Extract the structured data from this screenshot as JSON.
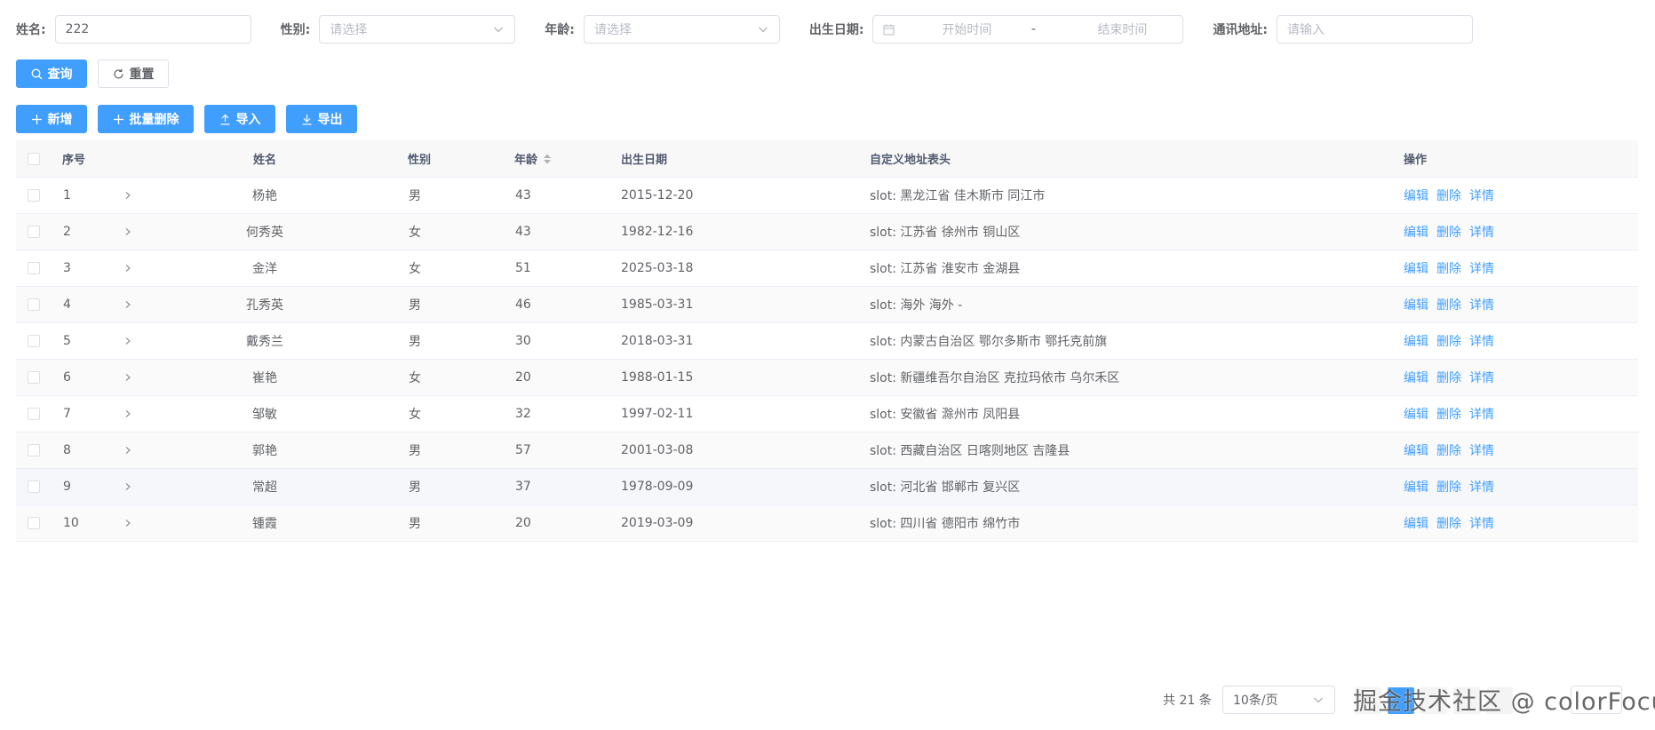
{
  "filters": {
    "name": {
      "label": "姓名:",
      "value": "222"
    },
    "gender": {
      "label": "性别:",
      "placeholder": "请选择"
    },
    "age": {
      "label": "年龄:",
      "placeholder": "请选择"
    },
    "birthdate": {
      "label": "出生日期:",
      "start_placeholder": "开始时间",
      "separator": "-",
      "end_placeholder": "结束时间"
    },
    "address": {
      "label": "通讯地址:",
      "placeholder": "请输入"
    }
  },
  "search_buttons": {
    "query": "查询",
    "reset": "重置"
  },
  "toolbar": {
    "add": "新增",
    "batch_delete": "批量删除",
    "import": "导入",
    "export": "导出"
  },
  "table": {
    "headers": {
      "index": "序号",
      "name": "姓名",
      "gender": "性别",
      "age": "年龄",
      "birthdate": "出生日期",
      "address": "自定义地址表头",
      "actions": "操作"
    },
    "actions": {
      "edit": "编辑",
      "delete": "删除",
      "detail": "详情"
    },
    "rows": [
      {
        "index": "1",
        "name": "杨艳",
        "gender": "男",
        "age": "43",
        "birthdate": "2015-12-20",
        "address": "slot: 黑龙江省 佳木斯市 同江市"
      },
      {
        "index": "2",
        "name": "何秀英",
        "gender": "女",
        "age": "43",
        "birthdate": "1982-12-16",
        "address": "slot: 江苏省 徐州市 铜山区"
      },
      {
        "index": "3",
        "name": "金洋",
        "gender": "女",
        "age": "51",
        "birthdate": "2025-03-18",
        "address": "slot: 江苏省 淮安市 金湖县"
      },
      {
        "index": "4",
        "name": "孔秀英",
        "gender": "男",
        "age": "46",
        "birthdate": "1985-03-31",
        "address": "slot: 海外 海外 -"
      },
      {
        "index": "5",
        "name": "戴秀兰",
        "gender": "男",
        "age": "30",
        "birthdate": "2018-03-31",
        "address": "slot: 内蒙古自治区 鄂尔多斯市 鄂托克前旗"
      },
      {
        "index": "6",
        "name": "崔艳",
        "gender": "女",
        "age": "20",
        "birthdate": "1988-01-15",
        "address": "slot: 新疆维吾尔自治区 克拉玛依市 乌尔禾区"
      },
      {
        "index": "7",
        "name": "邹敏",
        "gender": "女",
        "age": "32",
        "birthdate": "1997-02-11",
        "address": "slot: 安徽省 滁州市 凤阳县"
      },
      {
        "index": "8",
        "name": "郭艳",
        "gender": "男",
        "age": "57",
        "birthdate": "2001-03-08",
        "address": "slot: 西藏自治区 日喀则地区 吉隆县"
      },
      {
        "index": "9",
        "name": "常超",
        "gender": "男",
        "age": "37",
        "birthdate": "1978-09-09",
        "address": "slot: 河北省 邯郸市 复兴区"
      },
      {
        "index": "10",
        "name": "锺霞",
        "gender": "男",
        "age": "20",
        "birthdate": "2019-03-09",
        "address": "slot: 四川省 德阳市 绵竹市"
      }
    ]
  },
  "pagination": {
    "total": "共 21 条",
    "page_size": "10条/页"
  },
  "watermark": "掘金技术社区 @ colorFocus",
  "colors": {
    "primary": "#409eff",
    "border": "#dcdfe6",
    "header_bg": "#f8f8f9"
  }
}
